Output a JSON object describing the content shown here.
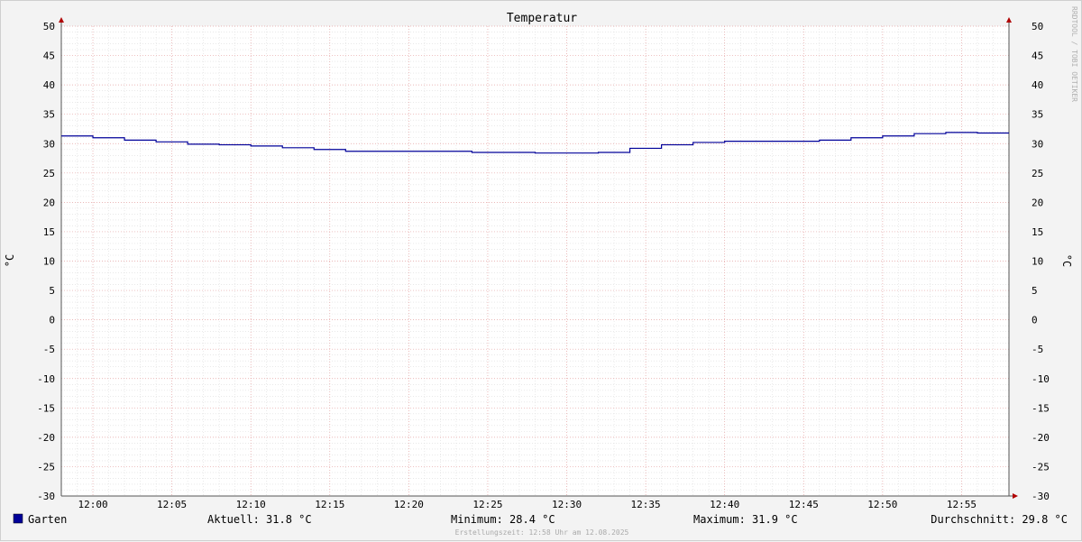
{
  "chart_data": {
    "type": "line",
    "title": "Temperatur",
    "ylabel": "°C",
    "ylabel_right": "°C",
    "ylim": [
      -30,
      50
    ],
    "y_ticks": [
      50,
      45,
      40,
      35,
      30,
      25,
      20,
      15,
      10,
      5,
      0,
      -5,
      -10,
      -15,
      -20,
      -25,
      -30
    ],
    "x_ticks": [
      "12:00",
      "12:05",
      "12:10",
      "12:15",
      "12:20",
      "12:25",
      "12:30",
      "12:35",
      "12:40",
      "12:45",
      "12:50",
      "12:55"
    ],
    "x_range_minutes": [
      -2,
      58
    ],
    "grid": true,
    "series": [
      {
        "name": "Garten",
        "color": "#000099",
        "step_minutes": [
          -2,
          0,
          2,
          4,
          6,
          8,
          10,
          12,
          14,
          16,
          18,
          20,
          22,
          24,
          26,
          28,
          30,
          32,
          34,
          36,
          38,
          40,
          42,
          44,
          46,
          48,
          50,
          52,
          54,
          56
        ],
        "values": [
          31.3,
          31.0,
          30.6,
          30.3,
          29.9,
          29.8,
          29.6,
          29.3,
          29.0,
          28.7,
          28.7,
          28.7,
          28.7,
          28.5,
          28.5,
          28.4,
          28.4,
          28.5,
          29.2,
          29.8,
          30.2,
          30.4,
          30.4,
          30.4,
          30.6,
          31.0,
          31.3,
          31.7,
          31.9,
          31.8
        ]
      }
    ],
    "legend": {
      "label": "Garten",
      "color": "#000099",
      "aktuell": "Aktuell: 31.8 °C",
      "minimum": "Minimum: 28.4 °C",
      "maximum": "Maximum: 31.9 °C",
      "durchschnitt": "Durchschnitt: 29.8 °C"
    },
    "watermark": "RRDTOOL / TOBI OETIKER",
    "footer": "Erstellungszeit: 12:58 Uhr am 12.08.2025"
  }
}
